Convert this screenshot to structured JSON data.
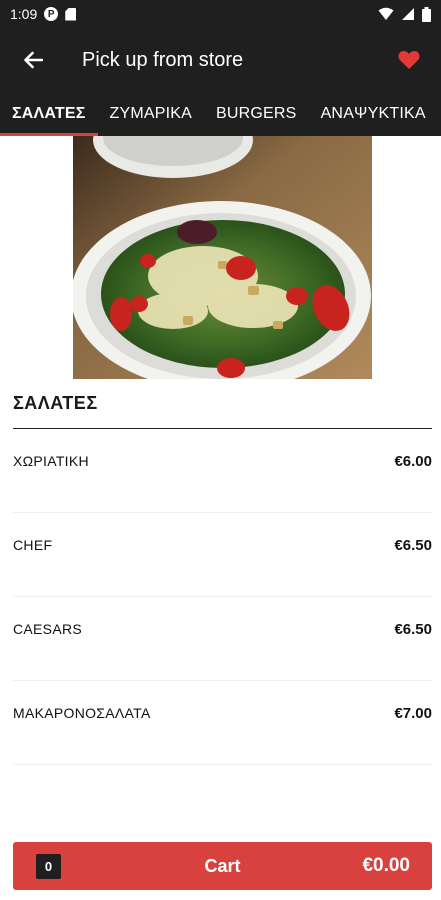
{
  "status_bar": {
    "time": "1:09",
    "badge_letter": "P"
  },
  "toolbar": {
    "title": "Pick up from store",
    "back_icon": "arrow-left-icon",
    "favorite_icon": "heart-icon",
    "favorite_color": "#e53935"
  },
  "tabs": [
    {
      "label": "ΣΑΛΑΤΕΣ",
      "active": true
    },
    {
      "label": "ΖΥΜΑΡΙΚΑ",
      "active": false
    },
    {
      "label": "BURGERS",
      "active": false
    },
    {
      "label": "ΑΝΑΨΥΚΤΙΚΑ",
      "active": false
    }
  ],
  "section": {
    "title": "ΣΑΛΑΤΕΣ"
  },
  "menu_items": [
    {
      "name": "ΧΩΡΙΑΤΙΚΗ",
      "price": "€6.00"
    },
    {
      "name": "CHEF",
      "price": "€6.50"
    },
    {
      "name": "CAESARS",
      "price": "€6.50"
    },
    {
      "name": "ΜΑΚΑΡΟΝΟΣΑΛΑΤΑ",
      "price": "€7.00"
    }
  ],
  "cart": {
    "count": "0",
    "label": "Cart",
    "total": "€0.00"
  },
  "colors": {
    "accent": "#d9413f",
    "toolbar_bg": "#1f1f1f"
  }
}
